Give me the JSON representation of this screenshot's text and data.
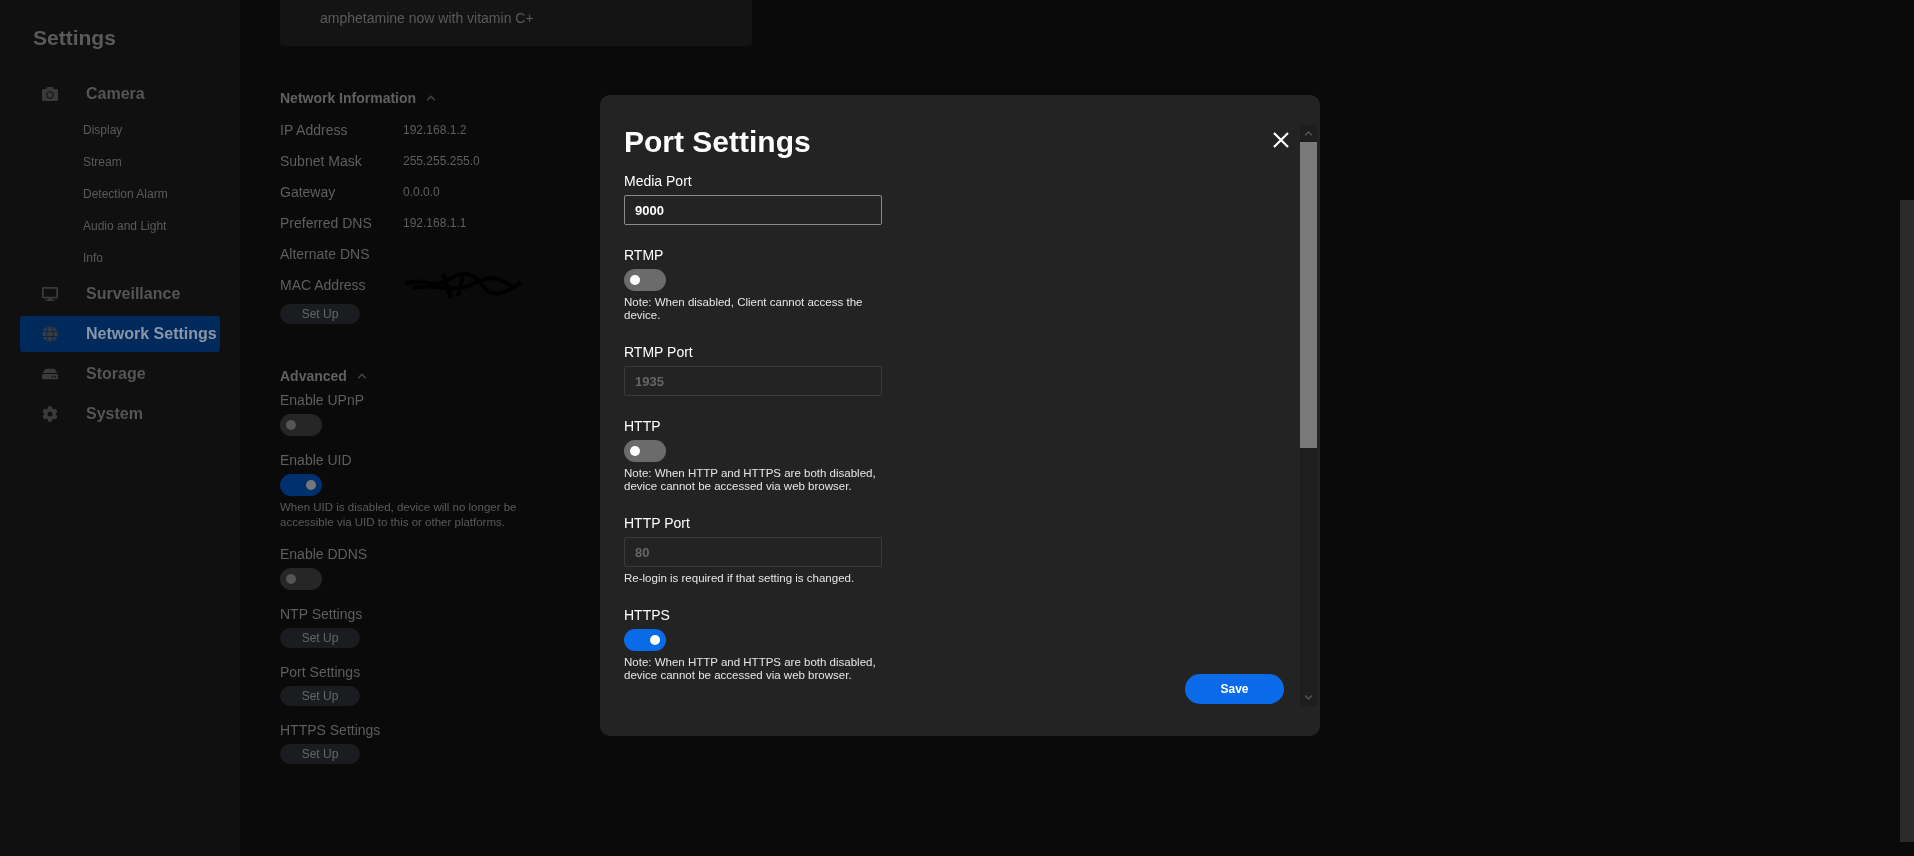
{
  "sidebar": {
    "title": "Settings",
    "items": [
      {
        "label": "Camera",
        "selected": false,
        "children": [
          {
            "label": "Display"
          },
          {
            "label": "Stream"
          },
          {
            "label": "Detection Alarm"
          },
          {
            "label": "Audio and Light"
          },
          {
            "label": "Info"
          }
        ]
      },
      {
        "label": "Surveillance",
        "selected": false
      },
      {
        "label": "Network Settings",
        "selected": true
      },
      {
        "label": "Storage",
        "selected": false
      },
      {
        "label": "System",
        "selected": false
      }
    ]
  },
  "top_card": {
    "text": "amphetamine now with vitamin C+"
  },
  "network_information": {
    "title": "Network Information",
    "expanded": true,
    "rows": [
      {
        "label": "IP Address",
        "value": "192.168.1.2"
      },
      {
        "label": "Subnet Mask",
        "value": "255.255.255.0"
      },
      {
        "label": "Gateway",
        "value": "0.0.0.0"
      },
      {
        "label": "Preferred DNS",
        "value": "192.168.1.1"
      },
      {
        "label": "Alternate DNS"
      },
      {
        "label": "MAC Address",
        "redacted": true
      }
    ],
    "button": "Set Up"
  },
  "advanced": {
    "title": "Advanced",
    "expanded": true,
    "items": [
      {
        "kind": "toggle",
        "label": "Enable UPnP",
        "on": false
      },
      {
        "kind": "toggle",
        "label": "Enable UID",
        "on": true,
        "note": "When UID is disabled, device will no longer be accessible via UID to this or other platforms."
      },
      {
        "kind": "toggle",
        "label": "Enable DDNS",
        "on": false
      },
      {
        "kind": "setup",
        "label": "NTP Settings",
        "button": "Set Up"
      },
      {
        "kind": "setup",
        "label": "Port Settings",
        "button": "Set Up"
      },
      {
        "kind": "setup",
        "label": "HTTPS Settings",
        "button": "Set Up"
      }
    ]
  },
  "dialog": {
    "title": "Port Settings",
    "fields": [
      {
        "kind": "input",
        "label": "Media Port",
        "value": "9000",
        "disabled": false
      },
      {
        "kind": "toggle",
        "label": "RTMP",
        "on": false,
        "note": "Note: When disabled, Client cannot access the device."
      },
      {
        "kind": "input",
        "label": "RTMP Port",
        "value": "1935",
        "disabled": true
      },
      {
        "kind": "toggle",
        "label": "HTTP",
        "on": false,
        "note": "Note: When HTTP and HTTPS are both disabled, device cannot be accessed via web browser."
      },
      {
        "kind": "input",
        "label": "HTTP Port",
        "value": "80",
        "disabled": true,
        "note": "Re-login is required if that setting is changed."
      },
      {
        "kind": "toggle",
        "label": "HTTPS",
        "on": true,
        "note": "Note: When HTTP and HTTPS are both disabled, device cannot be accessed via web browser."
      }
    ],
    "save": "Save"
  }
}
